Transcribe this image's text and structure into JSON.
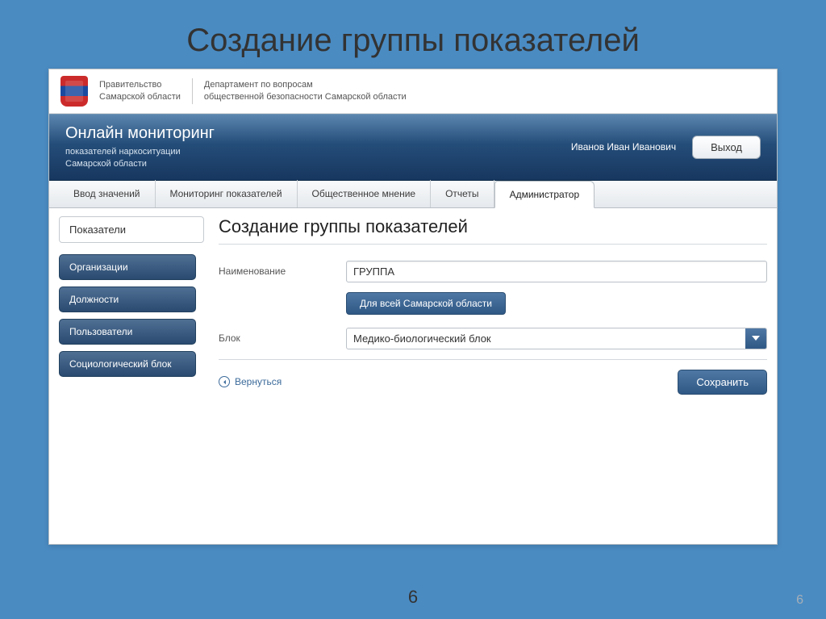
{
  "slide": {
    "title": "Создание группы показателей",
    "number_center": "6",
    "number_corner": "6"
  },
  "gov_header": {
    "org_line1": "Правительство",
    "org_line2": "Самарской области",
    "dept_line1": "Департамент по вопросам",
    "dept_line2": "общественной безопасности Самарской области"
  },
  "blue_bar": {
    "title": "Онлайн мониторинг",
    "sub_line1": "показателей наркоситуации",
    "sub_line2": "Самарской области",
    "username": "Иванов Иван Иванович",
    "logout": "Выход"
  },
  "tabs": {
    "items": [
      "Ввод значений",
      "Мониторинг показателей",
      "Общественное мнение",
      "Отчеты",
      "Администратор"
    ]
  },
  "sidebar": {
    "active": "Показатели",
    "items": [
      "Организации",
      "Должности",
      "Пользователи",
      "Социологический блок"
    ]
  },
  "main": {
    "heading": "Создание группы показателей",
    "label_name": "Наименование",
    "value_name": "ГРУППА",
    "region_button": "Для всей Самарской области",
    "label_block": "Блок",
    "value_block": "Медико-биологический блок",
    "back_link": "Вернуться",
    "save_button": "Сохранить"
  }
}
